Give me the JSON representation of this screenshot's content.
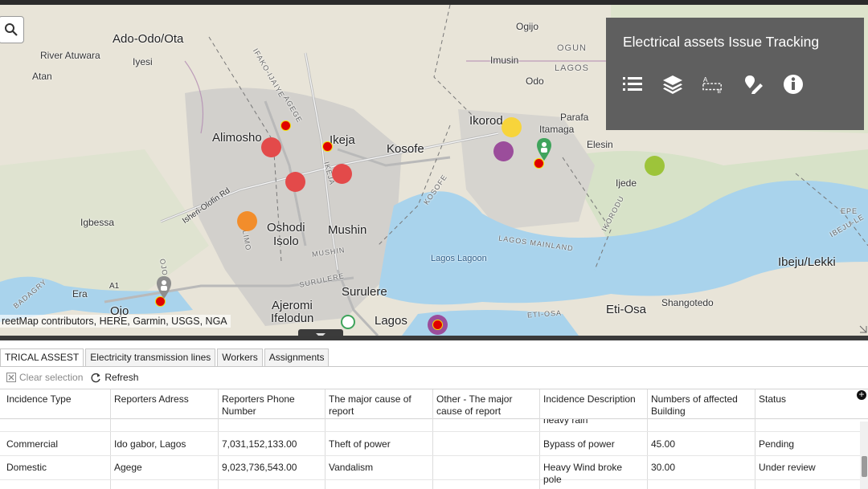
{
  "map": {
    "attribution": "reetMap contributors, HERE, Garmin, USGS, NGA",
    "places": [
      {
        "id": "ado-odo-ota",
        "text": "Ado-Odo/Ota",
        "size": "big"
      },
      {
        "id": "river-atuwara",
        "text": "River Atuwara",
        "size": "small"
      },
      {
        "id": "iyesi",
        "text": "Iyesi",
        "size": "small"
      },
      {
        "id": "atan",
        "text": "Atan",
        "size": "small"
      },
      {
        "id": "alimosho",
        "text": "Alimosho",
        "size": "big"
      },
      {
        "id": "ikeja",
        "text": "Ikeja",
        "size": "big"
      },
      {
        "id": "kosofe",
        "text": "Kosofe",
        "size": "big"
      },
      {
        "id": "ikorodu",
        "text": "Ikorod",
        "size": "big"
      },
      {
        "id": "itamaga",
        "text": "Itamaga",
        "size": "small"
      },
      {
        "id": "parafa",
        "text": "Parafa",
        "size": "small"
      },
      {
        "id": "elesin",
        "text": "Elesin",
        "size": "small"
      },
      {
        "id": "ijede",
        "text": "Ijede",
        "size": "small"
      },
      {
        "id": "igbessa",
        "text": "Igbessa",
        "size": "small"
      },
      {
        "id": "oshodi-isolo",
        "text": "Oshodi",
        "size": "big"
      },
      {
        "id": "isolo",
        "text": "Isolo",
        "size": "big"
      },
      {
        "id": "mushin",
        "text": "Mushin",
        "size": "big"
      },
      {
        "id": "surulere",
        "text": "Surulere",
        "size": "big"
      },
      {
        "id": "ajeromi",
        "text": "Ajeromi",
        "size": "big"
      },
      {
        "id": "ifelodun",
        "text": "Ifelodun",
        "size": "big"
      },
      {
        "id": "lagos",
        "text": "Lagos",
        "size": "big"
      },
      {
        "id": "eti-osa",
        "text": "Eti-Osa",
        "size": "big"
      },
      {
        "id": "shangotedo",
        "text": "Shangotedo",
        "size": "small"
      },
      {
        "id": "ibeju-lekki",
        "text": "Ibeju/Lekki",
        "size": "big"
      },
      {
        "id": "ojo",
        "text": "Ojo",
        "size": "big"
      },
      {
        "id": "era",
        "text": "Era",
        "size": "small"
      },
      {
        "id": "ogijo",
        "text": "Ogijo",
        "size": "small"
      },
      {
        "id": "ogun",
        "text": "OGUN",
        "size": "road"
      },
      {
        "id": "lagos-state",
        "text": "LAGOS",
        "size": "road"
      },
      {
        "id": "imusin",
        "text": "Imusin",
        "size": "small"
      },
      {
        "id": "odo",
        "text": "Odo",
        "size": "small"
      },
      {
        "id": "lagos-lagoon",
        "text": "Lagos Lagoon",
        "size": "water"
      },
      {
        "id": "lagos-mainland",
        "text": "LAGOS MAINLAND",
        "size": "road"
      },
      {
        "id": "mushin-road",
        "text": "MUSHIN",
        "size": "road"
      },
      {
        "id": "surulere-road",
        "text": "SURULERE",
        "size": "road"
      },
      {
        "id": "eti-osa-road",
        "text": "ETI-OSA",
        "size": "road"
      },
      {
        "id": "ikorodu-road",
        "text": "IKORODU",
        "size": "road"
      },
      {
        "id": "kosofe-road",
        "text": "KOSOFE",
        "size": "road"
      },
      {
        "id": "isheri-rd",
        "text": "Isheri-Olofin Rd",
        "size": "small"
      },
      {
        "id": "ifako",
        "text": "IFAKO-IJAIYE",
        "size": "road"
      },
      {
        "id": "agege",
        "text": "AGEGE",
        "size": "road"
      },
      {
        "id": "ikeja-road",
        "text": "IKEJA",
        "size": "road"
      },
      {
        "id": "alimosho-road",
        "text": "ALIMO",
        "size": "road"
      },
      {
        "id": "epe",
        "text": "EPE",
        "size": "road"
      },
      {
        "id": "ibeju-road",
        "text": "IBEJU-LE",
        "size": "road"
      },
      {
        "id": "badagry",
        "text": "BADAGRY",
        "size": "road"
      },
      {
        "id": "a1",
        "text": "A1",
        "size": "small"
      },
      {
        "id": "ojo-road",
        "text": "OJO",
        "size": "road"
      }
    ],
    "colors": {
      "red": "#e34a4a",
      "orange": "#f28d2b",
      "yellow": "#f7d43b",
      "purple": "#9b4d9b",
      "green": "#9dc43a",
      "pin": "#3fa45c",
      "gray_pin": "#8e8e8e",
      "water": "#a9d3ec"
    }
  },
  "panel": {
    "title": "Electrical assets Issue Tracking",
    "tools": [
      "list-icon",
      "layers-icon",
      "attribute-table-icon",
      "edit-icon",
      "info-icon"
    ]
  },
  "tabs": [
    {
      "label": "TRICAL ASSEST",
      "active": true
    },
    {
      "label": "Electricity transmission lines",
      "active": false
    },
    {
      "label": "Workers",
      "active": false
    },
    {
      "label": "Assignments",
      "active": false
    }
  ],
  "toolbar": {
    "clear_selection": "Clear selection",
    "refresh": "Refresh"
  },
  "table": {
    "columns": [
      "Incidence Type",
      "Reporters Adress",
      "Reporters Phone Number",
      "The major cause of report",
      "Other - The major cause of report",
      "Incidence Description",
      "Numbers of affected Building",
      "Status"
    ],
    "partial_row_text": "heavy rain",
    "rows": [
      [
        "Commercial",
        "Ido gabor, Lagos",
        "7,031,152,133.00",
        "Theft of power",
        "",
        "Bypass of power",
        "45.00",
        "Pending"
      ],
      [
        "Domestic",
        "Agege",
        "9,023,736,543.00",
        "Vandalism",
        "",
        "Heavy Wind broke pole",
        "30.00",
        "Under review"
      ]
    ]
  }
}
